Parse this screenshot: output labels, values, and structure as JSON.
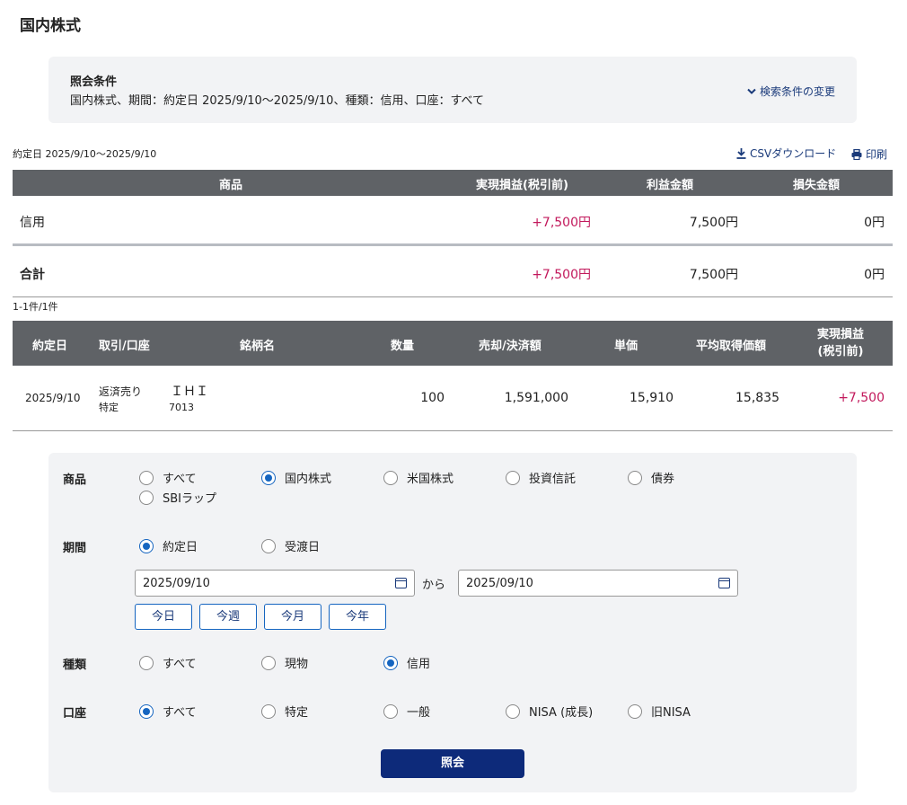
{
  "page": {
    "title": "国内株式"
  },
  "conditions": {
    "label": "照会条件",
    "text": "国内株式、期間：約定日 2025/9/10〜2025/9/10、種類：信用、口座：すべて",
    "change_link": "検索条件の変更"
  },
  "toolbar": {
    "period_note": "約定日 2025/9/10〜2025/9/10",
    "csv_label": "CSVダウンロード",
    "print_label": "印刷"
  },
  "summary": {
    "headers": {
      "product": "商品",
      "realized": "実現損益(税引前)",
      "profit": "利益金額",
      "loss": "損失金額"
    },
    "rows": [
      {
        "product": "信用",
        "realized": "+7,500円",
        "profit": "7,500円",
        "loss": "0円"
      }
    ],
    "total": {
      "label": "合計",
      "realized": "+7,500円",
      "profit": "7,500円",
      "loss": "0円"
    }
  },
  "detail": {
    "count_note": "1-1件/1件",
    "headers": {
      "date": "約定日",
      "trade": "取引/口座",
      "name": "銘柄名",
      "qty": "数量",
      "amount": "売却/決済額",
      "price": "単価",
      "avg": "平均取得価額",
      "realized_line1": "実現損益",
      "realized_line2": "(税引前)"
    },
    "rows": [
      {
        "date": "2025/9/10",
        "trade": "返済売り",
        "account": "特定",
        "name": "ＩＨＩ",
        "code": "7013",
        "qty": "100",
        "amount": "1,591,000",
        "price": "15,910",
        "avg": "15,835",
        "realized": "+7,500"
      }
    ]
  },
  "form": {
    "product": {
      "label": "商品",
      "options": [
        "すべて",
        "国内株式",
        "米国株式",
        "投資信託",
        "債券",
        "SBIラップ"
      ],
      "selected": "国内株式"
    },
    "period": {
      "label": "期間",
      "options": [
        "約定日",
        "受渡日"
      ],
      "selected": "約定日",
      "from": "2025/09/10",
      "to": "2025/09/10",
      "separator": "から",
      "quick": [
        "今日",
        "今週",
        "今月",
        "今年"
      ]
    },
    "type": {
      "label": "種類",
      "options": [
        "すべて",
        "現物",
        "信用"
      ],
      "selected": "信用"
    },
    "account": {
      "label": "口座",
      "options": [
        "すべて",
        "特定",
        "一般",
        "NISA (成長)",
        "旧NISA"
      ],
      "selected": "すべて"
    },
    "submit": "照会"
  },
  "colors": {
    "header_bg": "#5f6266",
    "accent": "#1565c0",
    "profit": "#c2185b",
    "submit_bg": "#0d2a7a"
  },
  "icons": {
    "change": "chevron-down-icon",
    "csv": "download-icon",
    "print": "printer-icon",
    "date": "calendar-icon"
  }
}
